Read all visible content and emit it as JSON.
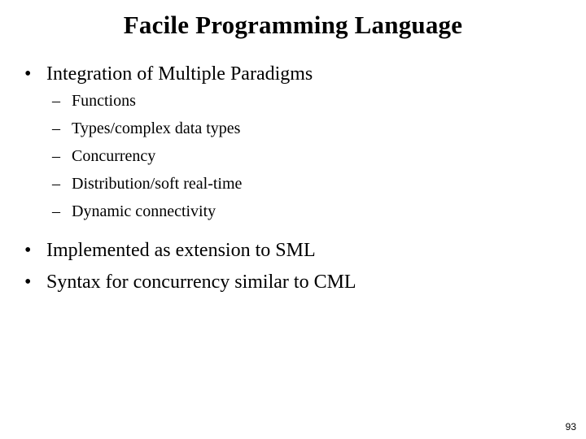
{
  "slide": {
    "title": "Facile Programming Language",
    "page_number": "93",
    "background_color": "#ffffff",
    "text_color": "#000000",
    "bullet_marker": "•",
    "sub_bullet_marker": "–",
    "content": [
      {
        "level": 1,
        "text": "Integration of Multiple Paradigms"
      },
      {
        "level": 2,
        "text": "Functions"
      },
      {
        "level": 2,
        "text": "Types/complex data types"
      },
      {
        "level": 2,
        "text": "Concurrency"
      },
      {
        "level": 2,
        "text": "Distribution/soft real-time"
      },
      {
        "level": 2,
        "text": "Dynamic connectivity"
      },
      {
        "level": 1,
        "text": "Implemented as extension to SML"
      },
      {
        "level": 1,
        "text": "Syntax for concurrency similar to CML"
      }
    ]
  }
}
